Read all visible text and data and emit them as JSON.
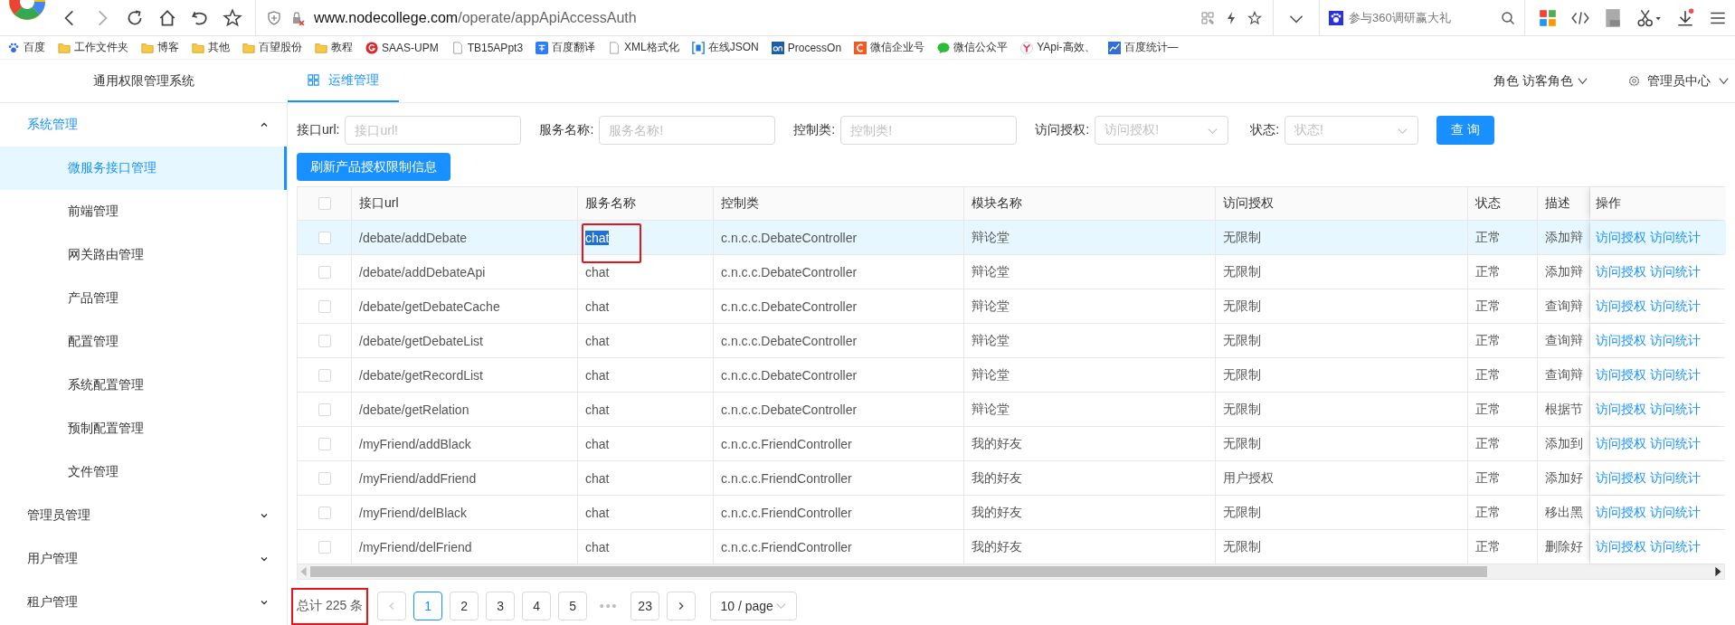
{
  "browser": {
    "url_domain": "www.nodecollege.com",
    "url_path": "/operate/appApiAccessAuth",
    "search_placeholder": "参与360调研赢大礼",
    "bookmarks": [
      {
        "label": "百度",
        "kind": "paw"
      },
      {
        "label": "工作文件夹",
        "kind": "folder"
      },
      {
        "label": "博客",
        "kind": "folder"
      },
      {
        "label": "其他",
        "kind": "folder"
      },
      {
        "label": "百望股份",
        "kind": "folder"
      },
      {
        "label": "教程",
        "kind": "folder"
      },
      {
        "label": "SAAS-UPM",
        "kind": "red"
      },
      {
        "label": "TB15APpt3",
        "kind": "page"
      },
      {
        "label": "百度翻译",
        "kind": "translate"
      },
      {
        "label": "XML格式化",
        "kind": "page"
      },
      {
        "label": "在线JSON",
        "kind": "bracket"
      },
      {
        "label": "ProcessOn",
        "kind": "on"
      },
      {
        "label": "微信企业号",
        "kind": "orange"
      },
      {
        "label": "微信公众平",
        "kind": "chat"
      },
      {
        "label": "YApi-高效、",
        "kind": "y"
      },
      {
        "label": "百度统计—",
        "kind": "chart"
      }
    ]
  },
  "app": {
    "title": "通用权限管理系统",
    "tabs": [
      {
        "label": "运维管理",
        "selected": true
      }
    ],
    "role_label": "角色",
    "role": "访客角色",
    "admin": "管理员中心"
  },
  "sidebar": [
    {
      "label": "系统管理",
      "expanded": true,
      "children": [
        {
          "label": "微服务接口管理",
          "selected": true
        },
        {
          "label": "前端管理",
          "selected": false
        },
        {
          "label": "网关路由管理",
          "selected": false
        },
        {
          "label": "产品管理",
          "selected": false
        },
        {
          "label": "配置管理",
          "selected": false
        },
        {
          "label": "系统配置管理",
          "selected": false
        },
        {
          "label": "预制配置管理",
          "selected": false
        },
        {
          "label": "文件管理",
          "selected": false
        }
      ]
    },
    {
      "label": "管理员管理",
      "expanded": false
    },
    {
      "label": "用户管理",
      "expanded": false
    },
    {
      "label": "租户管理",
      "expanded": false
    }
  ],
  "filters": [
    {
      "label": "接口url:",
      "placeholder": "接口url!",
      "kind": "input"
    },
    {
      "label": "服务名称:",
      "placeholder": "服务名称!",
      "kind": "input"
    },
    {
      "label": "控制类:",
      "placeholder": "控制类!",
      "kind": "input"
    },
    {
      "label": "访问授权:",
      "placeholder": "访问授权!",
      "kind": "select"
    },
    {
      "label": "状态:",
      "placeholder": "状态!",
      "kind": "select"
    }
  ],
  "query_button": "查 询",
  "refresh_button": "刷新产品授权限制信息",
  "table": {
    "header_checked": false,
    "columns": [
      "接口url",
      "服务名称",
      "控制类",
      "模块名称",
      "访问授权",
      "状态",
      "描述",
      "操作"
    ],
    "rows": [
      {
        "checked": false,
        "selected": true,
        "marked": true,
        "url": "/debate/addDebate",
        "service": "chat",
        "controller": "c.n.c.c.DebateController",
        "module": "辩论堂",
        "access": "无限制",
        "status": "正常",
        "description": "添加辩",
        "actions": [
          "访问授权",
          "访问统计"
        ]
      },
      {
        "checked": false,
        "selected": false,
        "marked": false,
        "url": "/debate/addDebateApi",
        "service": "chat",
        "controller": "c.n.c.c.DebateController",
        "module": "辩论堂",
        "access": "无限制",
        "status": "正常",
        "description": "添加辩",
        "actions": [
          "访问授权",
          "访问统计"
        ]
      },
      {
        "checked": false,
        "selected": false,
        "marked": false,
        "url": "/debate/getDebateCache",
        "service": "chat",
        "controller": "c.n.c.c.DebateController",
        "module": "辩论堂",
        "access": "无限制",
        "status": "正常",
        "description": "查询辩",
        "actions": [
          "访问授权",
          "访问统计"
        ]
      },
      {
        "checked": false,
        "selected": false,
        "marked": false,
        "url": "/debate/getDebateList",
        "service": "chat",
        "controller": "c.n.c.c.DebateController",
        "module": "辩论堂",
        "access": "无限制",
        "status": "正常",
        "description": "查询辩",
        "actions": [
          "访问授权",
          "访问统计"
        ]
      },
      {
        "checked": false,
        "selected": false,
        "marked": false,
        "url": "/debate/getRecordList",
        "service": "chat",
        "controller": "c.n.c.c.DebateController",
        "module": "辩论堂",
        "access": "无限制",
        "status": "正常",
        "description": "查询辩",
        "actions": [
          "访问授权",
          "访问统计"
        ]
      },
      {
        "checked": false,
        "selected": false,
        "marked": false,
        "url": "/debate/getRelation",
        "service": "chat",
        "controller": "c.n.c.c.DebateController",
        "module": "辩论堂",
        "access": "无限制",
        "status": "正常",
        "description": "根据节",
        "actions": [
          "访问授权",
          "访问统计"
        ]
      },
      {
        "checked": false,
        "selected": false,
        "marked": false,
        "url": "/myFriend/addBlack",
        "service": "chat",
        "controller": "c.n.c.c.FriendController",
        "module": "我的好友",
        "access": "无限制",
        "status": "正常",
        "description": "添加到",
        "actions": [
          "访问授权",
          "访问统计"
        ]
      },
      {
        "checked": false,
        "selected": false,
        "marked": false,
        "url": "/myFriend/addFriend",
        "service": "chat",
        "controller": "c.n.c.c.FriendController",
        "module": "我的好友",
        "access": "用户授权",
        "status": "正常",
        "description": "添加好",
        "actions": [
          "访问授权",
          "访问统计"
        ]
      },
      {
        "checked": false,
        "selected": false,
        "marked": false,
        "url": "/myFriend/delBlack",
        "service": "chat",
        "controller": "c.n.c.c.FriendController",
        "module": "我的好友",
        "access": "无限制",
        "status": "正常",
        "description": "移出黑",
        "actions": [
          "访问授权",
          "访问统计"
        ]
      },
      {
        "checked": false,
        "selected": false,
        "marked": false,
        "url": "/myFriend/delFriend",
        "service": "chat",
        "controller": "c.n.c.c.FriendController",
        "module": "我的好友",
        "access": "无限制",
        "status": "正常",
        "description": "删除好",
        "actions": [
          "访问授权",
          "访问统计"
        ]
      }
    ]
  },
  "pagination": {
    "total": "总计 225 条",
    "total_marked": true,
    "pages": [
      {
        "label": "1",
        "selected": true,
        "kind": "page"
      },
      {
        "label": "2",
        "selected": false,
        "kind": "page"
      },
      {
        "label": "3",
        "selected": false,
        "kind": "page"
      },
      {
        "label": "4",
        "selected": false,
        "kind": "page"
      },
      {
        "label": "5",
        "selected": false,
        "kind": "page"
      },
      {
        "label": "•••",
        "kind": "ellipsis"
      },
      {
        "label": "23",
        "selected": false,
        "kind": "page"
      }
    ],
    "page_size": "10 / page"
  }
}
